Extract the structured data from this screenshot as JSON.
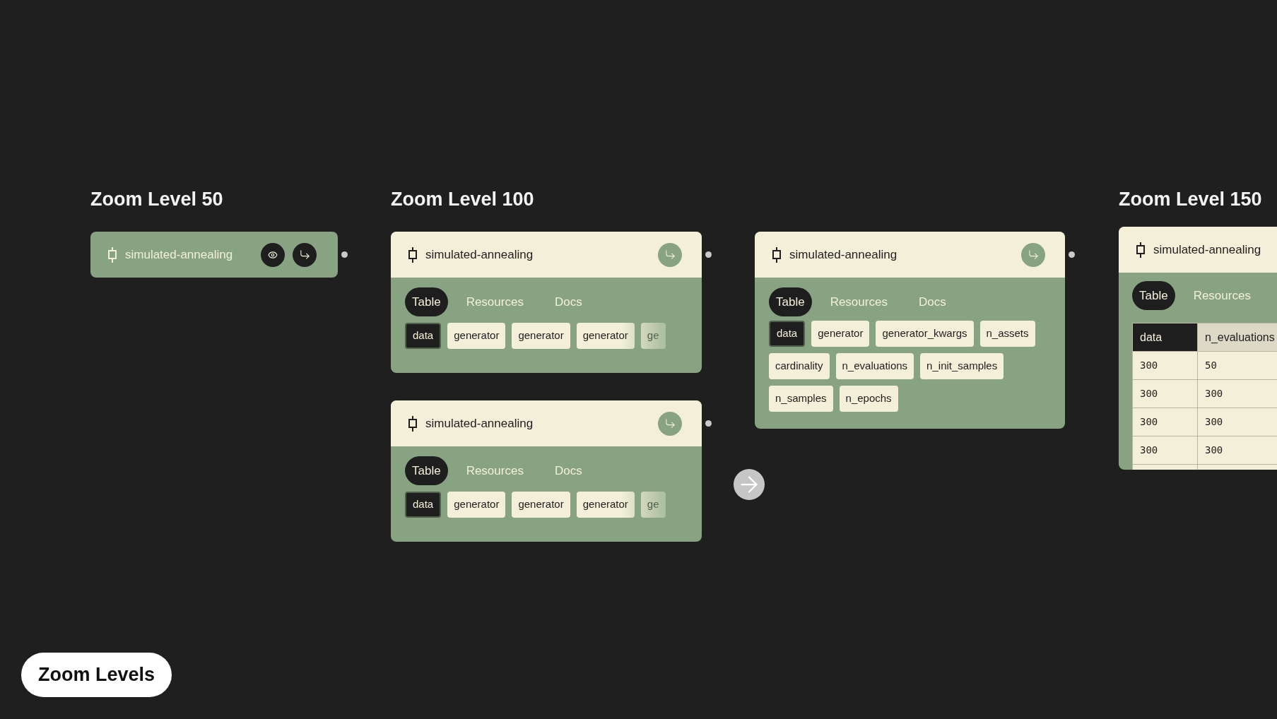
{
  "sections": [
    {
      "title": "Zoom Level 50"
    },
    {
      "title": "Zoom Level 100"
    },
    {
      "title": "Zoom Level 150"
    }
  ],
  "nodes": [
    {
      "kind": "compact",
      "title": "simulated-annealing"
    },
    {
      "kind": "chip-row",
      "title": "simulated-annealing",
      "tabs": [
        {
          "label": "Table",
          "selected": true
        },
        {
          "label": "Resources",
          "selected": false
        },
        {
          "label": "Docs",
          "selected": false
        }
      ],
      "chips": [
        {
          "label": "data",
          "selected": true
        },
        {
          "label": "generator",
          "selected": false
        },
        {
          "label": "generator",
          "selected": false
        },
        {
          "label": "generator",
          "selected": false
        },
        {
          "label": "ge",
          "selected": false
        }
      ]
    },
    {
      "kind": "chip-row",
      "title": "simulated-annealing",
      "tabs": [
        {
          "label": "Table",
          "selected": true
        },
        {
          "label": "Resources",
          "selected": false
        },
        {
          "label": "Docs",
          "selected": false
        }
      ],
      "chips": [
        {
          "label": "data",
          "selected": true
        },
        {
          "label": "generator",
          "selected": false
        },
        {
          "label": "generator",
          "selected": false
        },
        {
          "label": "generator",
          "selected": false
        },
        {
          "label": "ge",
          "selected": false
        }
      ]
    },
    {
      "kind": "chip-grid",
      "title": "simulated-annealing",
      "tabs": [
        {
          "label": "Table",
          "selected": true
        },
        {
          "label": "Resources",
          "selected": false
        },
        {
          "label": "Docs",
          "selected": false
        }
      ],
      "chips": [
        {
          "label": "data",
          "selected": true
        },
        {
          "label": "generator",
          "selected": false
        },
        {
          "label": "generator_kwargs",
          "selected": false
        },
        {
          "label": "n_assets",
          "selected": false
        },
        {
          "label": "cardinality",
          "selected": false
        },
        {
          "label": "n_evaluations",
          "selected": false
        },
        {
          "label": "n_init_samples",
          "selected": false
        },
        {
          "label": "n_samples",
          "selected": false
        },
        {
          "label": "n_epochs",
          "selected": false
        }
      ]
    },
    {
      "kind": "table",
      "title": "simulated-annealing",
      "tabs": [
        {
          "label": "Table",
          "selected": true
        },
        {
          "label": "Resources",
          "selected": false
        }
      ],
      "table": {
        "columns": [
          {
            "label": "data",
            "selected": true
          },
          {
            "label": "n_evaluations",
            "selected": false
          }
        ],
        "rows": [
          [
            "300",
            "50"
          ],
          [
            "300",
            "300"
          ],
          [
            "300",
            "300"
          ],
          [
            "300",
            "300"
          ]
        ]
      }
    }
  ],
  "footer": {
    "label": "Zoom Levels"
  }
}
